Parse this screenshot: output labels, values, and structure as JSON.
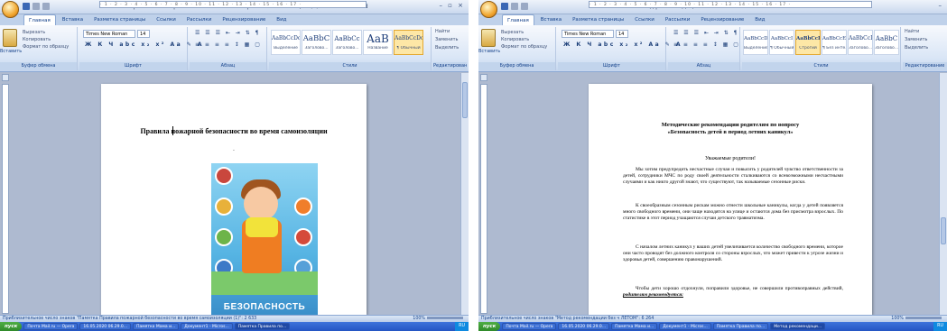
{
  "colors": {
    "accent": "#15428b",
    "ribbon": "#dae6f6",
    "taskbar": "#2455c3",
    "start": "#2f8a2a"
  },
  "windows": [
    {
      "title": "Памятка Правила пожарной безопасности во время самоизоляции (1) - Microsoft Word",
      "tabs": [
        "Главная",
        "Вставка",
        "Разметка страницы",
        "Ссылки",
        "Рассылки",
        "Рецензирование",
        "Вид"
      ],
      "clipboard": {
        "paste": "Вставить",
        "cut": "Вырезать",
        "copy": "Копировать",
        "format": "Формат по образцу",
        "label": "Буфер обмена"
      },
      "font": {
        "name": "Times New Roman",
        "size": "14",
        "label": "Шрифт"
      },
      "paragraph": {
        "label": "Абзац"
      },
      "styles": {
        "items": [
          {
            "sample": "AaBbCcDc",
            "name": "Выделение"
          },
          {
            "sample": "AaBbC",
            "name": "Заголово..."
          },
          {
            "sample": "AaBbCc",
            "name": "Заголово..."
          },
          {
            "sample": "AaB",
            "name": "Название"
          },
          {
            "sample": "AaBbCcDc",
            "name": "¶ Обычный"
          }
        ],
        "change": "Изменить стили",
        "label": "Стили"
      },
      "editing": {
        "find": "Найти",
        "replace": "Заменить",
        "select": "Выделить",
        "label": "Редактирование"
      },
      "document": {
        "title": "Правила пожарной безопасности во время самоизоляции",
        "dot": ".",
        "poster_caption": "БЕЗОПАСНОСТЬ"
      },
      "status": "Приблизительное число знаков \"Памятка Правила пожарной безопасности во время самоизоляции (1)\": 2 633",
      "zoom": "100%"
    },
    {
      "title": "Метод рекомендации без ч ЛЕТОМ - Microsoft Word",
      "tabs": [
        "Главная",
        "Вставка",
        "Разметка страницы",
        "Ссылки",
        "Рассылки",
        "Рецензирование",
        "Вид"
      ],
      "clipboard": {
        "paste": "Вставить",
        "cut": "Вырезать",
        "copy": "Копировать",
        "format": "Формат по образцу",
        "label": "Буфер обмена"
      },
      "font": {
        "name": "Times New Roman",
        "size": "14",
        "label": "Шрифт"
      },
      "paragraph": {
        "label": "Абзац"
      },
      "styles": {
        "items": [
          {
            "sample": "AaBbCcD",
            "name": "Выделение"
          },
          {
            "sample": "AaBbCcI",
            "name": "¶ Обычный"
          },
          {
            "sample": "AaBbCcI",
            "name": "Строгий"
          },
          {
            "sample": "AaBbCcE",
            "name": "¶ Без инте..."
          },
          {
            "sample": "AaBbCcI",
            "name": "Заголово..."
          },
          {
            "sample": "AaBbC",
            "name": "Заголово..."
          }
        ],
        "change": "Изменить стили",
        "label": "Стили"
      },
      "editing": {
        "find": "Найти",
        "replace": "Заменить",
        "select": "Выделить",
        "label": "Редактирование"
      },
      "document": {
        "title_line1": "Методические рекомендации родителям по вопросу",
        "title_line2": "«Безопасность детей в период летних каникул»",
        "greeting": "Уважаемые родители!",
        "p1": "Мы хотим предупредить несчастные случаи и повысить у родителей чувство ответственности за детей, сотрудники МЧС по роду своей деятельности сталкиваются со всевозможными несчастными случаями и как никто другой знают, что существуют, так называемые сезонные риски.",
        "p2": "К своеобразным сезонным рискам можно отнести школьные каникулы, когда у детей появляется много свободного времени, они чаще находятся на улице и остаются дома без присмотра взрослых. По статистике в этот период учащаются случаи детского травматизма.",
        "p3": "С началом летних каникул у ваших детей увеличивается количество свободного времени, которое они часто проводят без должного контроля со стороны взрослых, что может привести к угрозе жизни и здоровья детей, совершению правонарушений.",
        "p4_start": "Чтобы дети хорошо отдохнули, поправили здоровье, не совершили противоправных действий,",
        "p4_emph": "родителям рекомендуется:"
      },
      "status": "Приблизительное число знаков \"Метод рекомендации без ч ЛЕТОМ\": 6 264",
      "zoom": "100%"
    }
  ],
  "taskbar_left": {
    "start": "пуск",
    "tasks": [
      "Почта Mail.ru — Opera",
      "16.05.2020 06.29.0...",
      "Памятка Мама и...",
      "Документ1 - Micros...",
      "Памятка Правила по..."
    ],
    "tray": "RU"
  },
  "taskbar_right": {
    "start": "пуск",
    "tasks": [
      "Почта Mail.ru — Opera",
      "16.05.2020 06.29.0...",
      "Памятка Мама и...",
      "Документ1 - Micros...",
      "Памятка Правила по...",
      "Метод рекомендаци..."
    ],
    "tray": "RU"
  }
}
